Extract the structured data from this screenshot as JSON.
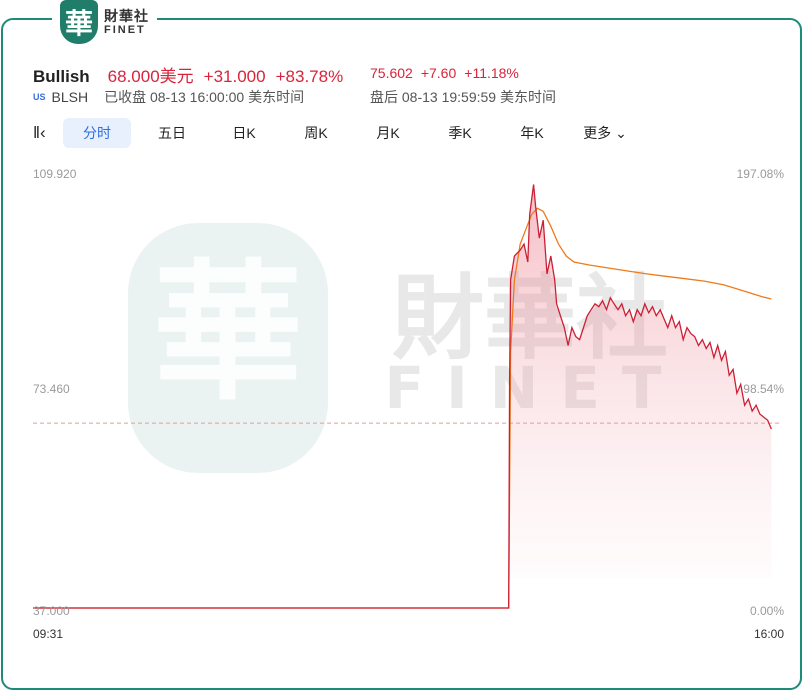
{
  "logo": {
    "mark": "華",
    "name_cn": "財華社",
    "name_en": "FINET"
  },
  "quote": {
    "name": "Bullish",
    "price": "68.000美元",
    "change": "+31.000",
    "change_pct": "+83.78%",
    "market_badge": "US",
    "ticker": "BLSH",
    "status": "已收盘 08-13 16:00:00 美东时间",
    "after_hours_price": "75.602",
    "after_hours_change": "+7.60",
    "after_hours_pct": "+11.18%",
    "after_hours_status": "盘后 08-13 19:59:59 美东时间"
  },
  "tabs": {
    "collapse_icon": "collapse-icon",
    "items": [
      "分时",
      "五日",
      "日K",
      "周K",
      "月K",
      "季K",
      "年K",
      "更多"
    ],
    "active": "分时"
  },
  "watermark": {
    "cn": "財華社",
    "en": "FINET"
  },
  "colors": {
    "price_line": "#cc1f35",
    "avg_line": "#f07a1a",
    "up": "#d9233a",
    "accent": "#2f6fe0",
    "frame": "#1f8a78"
  },
  "chart_data": {
    "type": "line",
    "y_left_ticks": [
      "109.920",
      "73.460",
      "37.000"
    ],
    "y_right_ticks": [
      "197.08%",
      "98.54%",
      "0.00%"
    ],
    "ylim": [
      37.0,
      109.92
    ],
    "prev_close": 68.0,
    "x_labels": [
      "09:31",
      "16:00"
    ],
    "x_range": [
      0,
      390
    ],
    "grid": false,
    "series": [
      {
        "role": "price",
        "points": [
          [
            0,
            37.0
          ],
          [
            248,
            37.0
          ],
          [
            248.5,
            75.2
          ],
          [
            249,
            92
          ],
          [
            251,
            96
          ],
          [
            254,
            97
          ],
          [
            256,
            98
          ],
          [
            258,
            95
          ],
          [
            259,
            103
          ],
          [
            261,
            108
          ],
          [
            262,
            104.5
          ],
          [
            264,
            99
          ],
          [
            266,
            102
          ],
          [
            268,
            93
          ],
          [
            270,
            96
          ],
          [
            272,
            92
          ],
          [
            273,
            88
          ],
          [
            275,
            86
          ],
          [
            277,
            84
          ],
          [
            279,
            81
          ],
          [
            281,
            84
          ],
          [
            283,
            82.5
          ],
          [
            285,
            82
          ],
          [
            287,
            84
          ],
          [
            289,
            86
          ],
          [
            291,
            87
          ],
          [
            293,
            88
          ],
          [
            295,
            87.5
          ],
          [
            297,
            88.5
          ],
          [
            299,
            87
          ],
          [
            301,
            89
          ],
          [
            303,
            88
          ],
          [
            305,
            87
          ],
          [
            307,
            88
          ],
          [
            309,
            86
          ],
          [
            311,
            87
          ],
          [
            313,
            85
          ],
          [
            315,
            87
          ],
          [
            317,
            86
          ],
          [
            319,
            88
          ],
          [
            321,
            86.5
          ],
          [
            323,
            87.5
          ],
          [
            325,
            86
          ],
          [
            327,
            87
          ],
          [
            329,
            85.5
          ],
          [
            331,
            84
          ],
          [
            333,
            86
          ],
          [
            335,
            84
          ],
          [
            337,
            85
          ],
          [
            339,
            82
          ],
          [
            341,
            84
          ],
          [
            343,
            83
          ],
          [
            345,
            82.5
          ],
          [
            347,
            81
          ],
          [
            349,
            82
          ],
          [
            351,
            80.5
          ],
          [
            353,
            81.5
          ],
          [
            355,
            79
          ],
          [
            357,
            81
          ],
          [
            359,
            78.5
          ],
          [
            361,
            80
          ],
          [
            363,
            76
          ],
          [
            365,
            77
          ],
          [
            367,
            73
          ],
          [
            369,
            74.5
          ],
          [
            371,
            71
          ],
          [
            373,
            72
          ],
          [
            375,
            70
          ],
          [
            377,
            71
          ],
          [
            379,
            69.5
          ],
          [
            381,
            69
          ],
          [
            383,
            68.5
          ],
          [
            385,
            67
          ]
        ]
      },
      {
        "role": "average",
        "points": [
          [
            0,
            37.0
          ],
          [
            248,
            37.0
          ],
          [
            249,
            80
          ],
          [
            251,
            92
          ],
          [
            254,
            98
          ],
          [
            257,
            100.5
          ],
          [
            260,
            103
          ],
          [
            263,
            104
          ],
          [
            266,
            103.5
          ],
          [
            270,
            101
          ],
          [
            274,
            98
          ],
          [
            278,
            96
          ],
          [
            282,
            95
          ],
          [
            290,
            94.5
          ],
          [
            300,
            94
          ],
          [
            310,
            93.5
          ],
          [
            320,
            93
          ],
          [
            330,
            92.6
          ],
          [
            340,
            92.2
          ],
          [
            350,
            91.8
          ],
          [
            360,
            91.2
          ],
          [
            370,
            90.2
          ],
          [
            380,
            89.2
          ],
          [
            385,
            88.8
          ]
        ]
      }
    ]
  }
}
